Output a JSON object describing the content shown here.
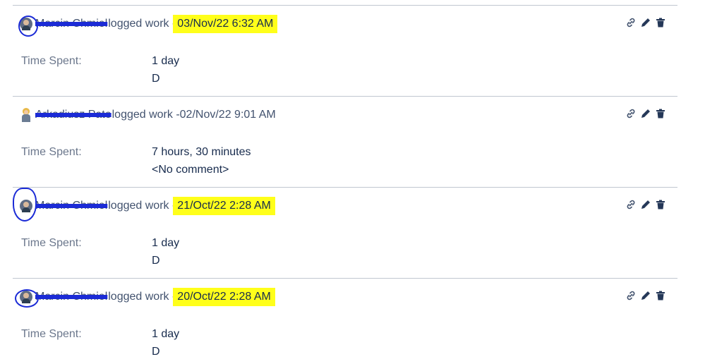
{
  "entries": [
    {
      "author": "Marcin Chmiel",
      "action": "logged work - ",
      "date": "03/Nov/22 6:32 AM",
      "time_label": "Time Spent:",
      "time_value": "1 day",
      "comment": "D"
    },
    {
      "author": "Arkadiusz Pate",
      "action": "logged work - ",
      "date": "02/Nov/22 9:01 AM",
      "time_label": "Time Spent:",
      "time_value": "7 hours, 30 minutes",
      "comment": "<No comment>"
    },
    {
      "author": "Marcin Chmiel",
      "action": "logged work - ",
      "date": "21/Oct/22 2:28 AM",
      "time_label": "Time Spent:",
      "time_value": "1 day",
      "comment": "D"
    },
    {
      "author": "Marcin Chmiel",
      "action": "logged work - ",
      "date": "20/Oct/22 2:28 AM",
      "time_label": "Time Spent:",
      "time_value": "1 day",
      "comment": "D"
    }
  ],
  "icons": {
    "link": "link-icon",
    "edit": "pencil-icon",
    "delete": "trash-icon"
  },
  "colors": {
    "highlight": "#ffff1a",
    "scribble": "#1b2bd6",
    "divider": "#c1c7d0"
  }
}
